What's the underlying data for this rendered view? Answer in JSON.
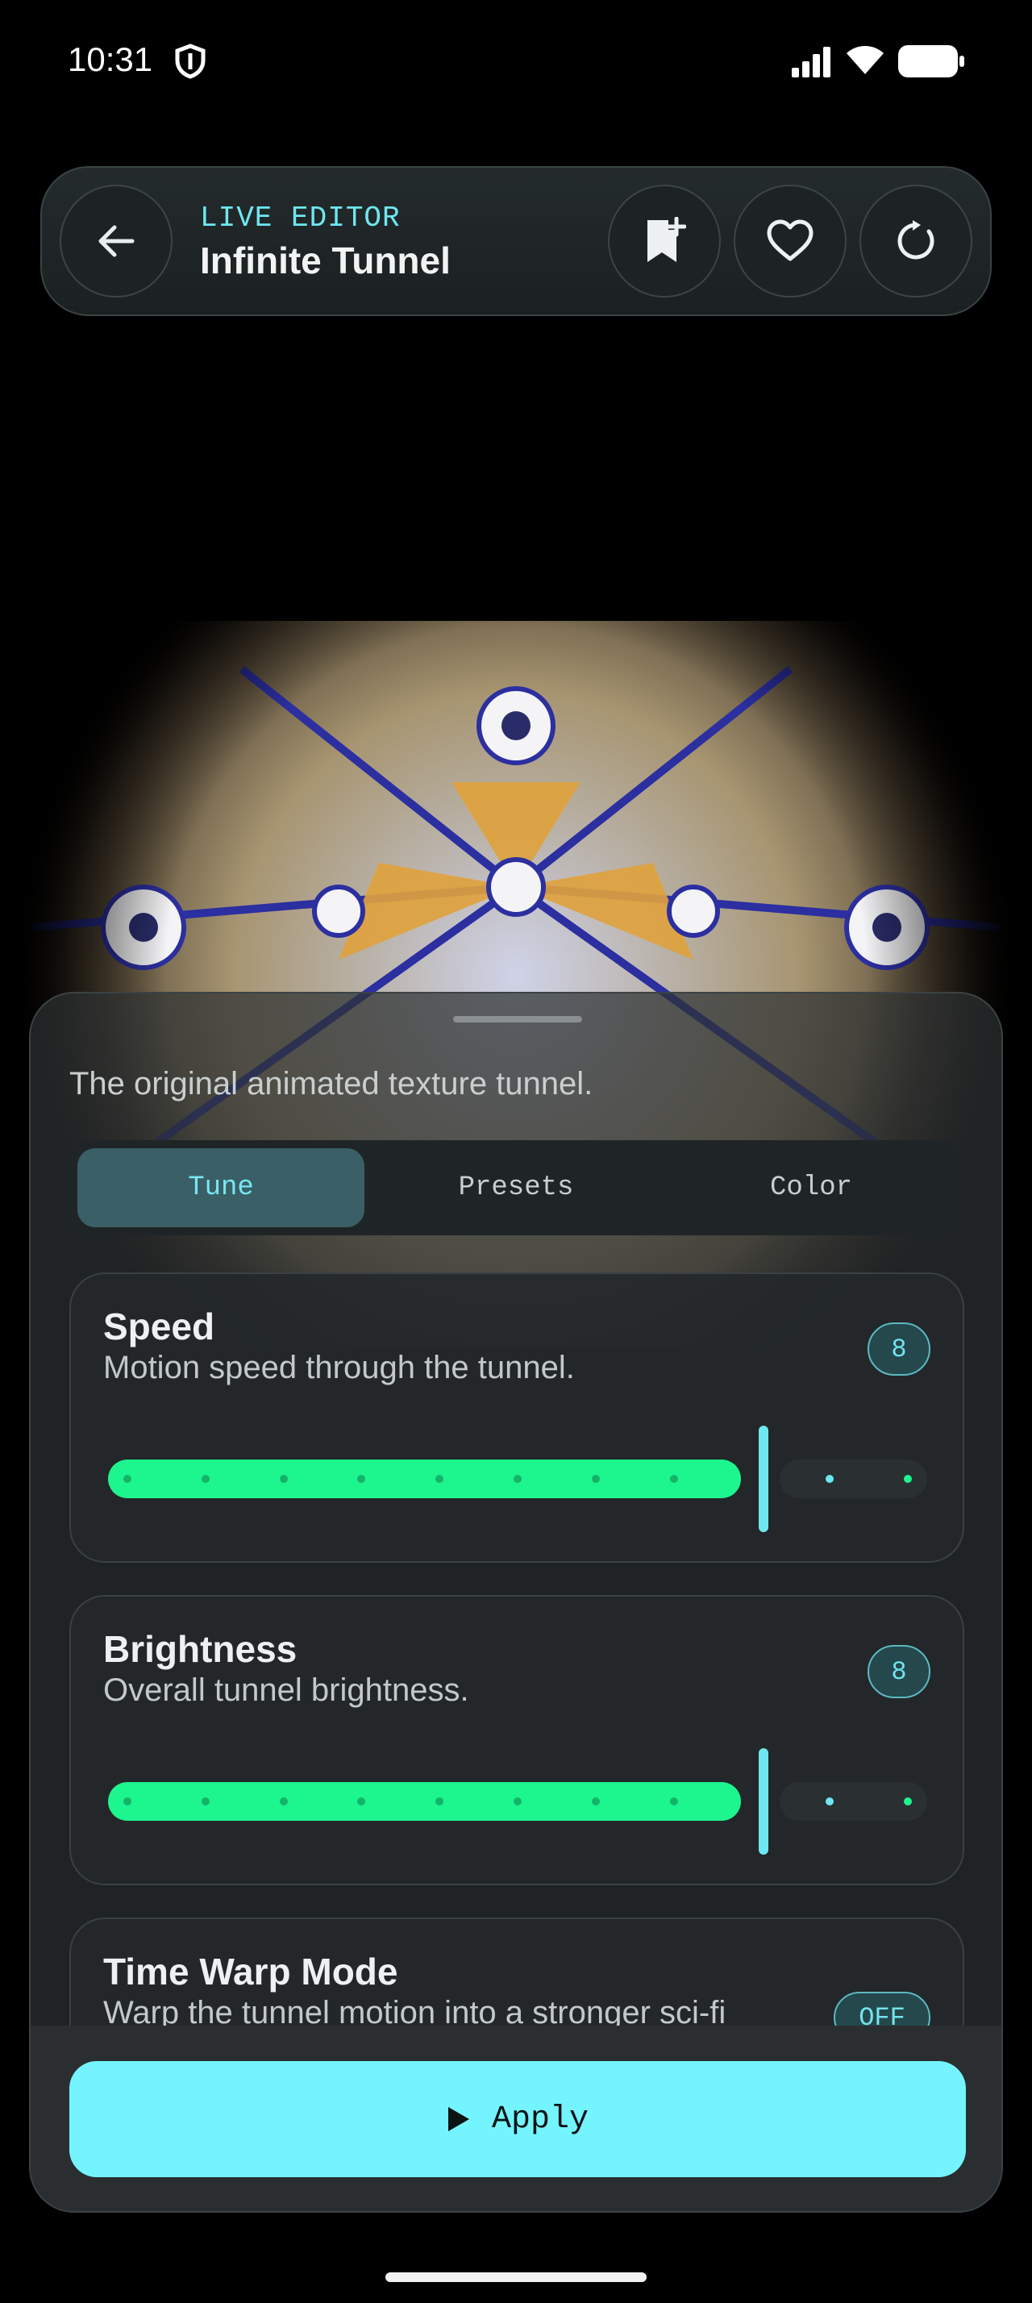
{
  "status_bar": {
    "time": "10:31"
  },
  "header": {
    "eyebrow": "LIVE EDITOR",
    "title": "Infinite Tunnel",
    "icons": [
      "back-arrow-icon",
      "bookmark-add-icon",
      "heart-icon",
      "refresh-icon"
    ]
  },
  "panel": {
    "description": "The original animated texture tunnel.",
    "tabs": [
      {
        "label": "Tune",
        "active": true
      },
      {
        "label": "Presets",
        "active": false
      },
      {
        "label": "Color",
        "active": false
      }
    ],
    "controls": [
      {
        "title": "Speed",
        "subtitle": "Motion speed through the tunnel.",
        "value": "8",
        "level": 8,
        "max": 10
      },
      {
        "title": "Brightness",
        "subtitle": "Overall tunnel brightness.",
        "value": "8",
        "level": 8,
        "max": 10
      },
      {
        "title": "Time Warp Mode",
        "subtitle": "Warp the tunnel motion into a stronger sci-fi",
        "toggle": "OFF"
      }
    ],
    "apply_label": "Apply"
  },
  "colors": {
    "accent": "#74f4ff",
    "slider_fill": "#1df58f",
    "background": "#000000"
  }
}
